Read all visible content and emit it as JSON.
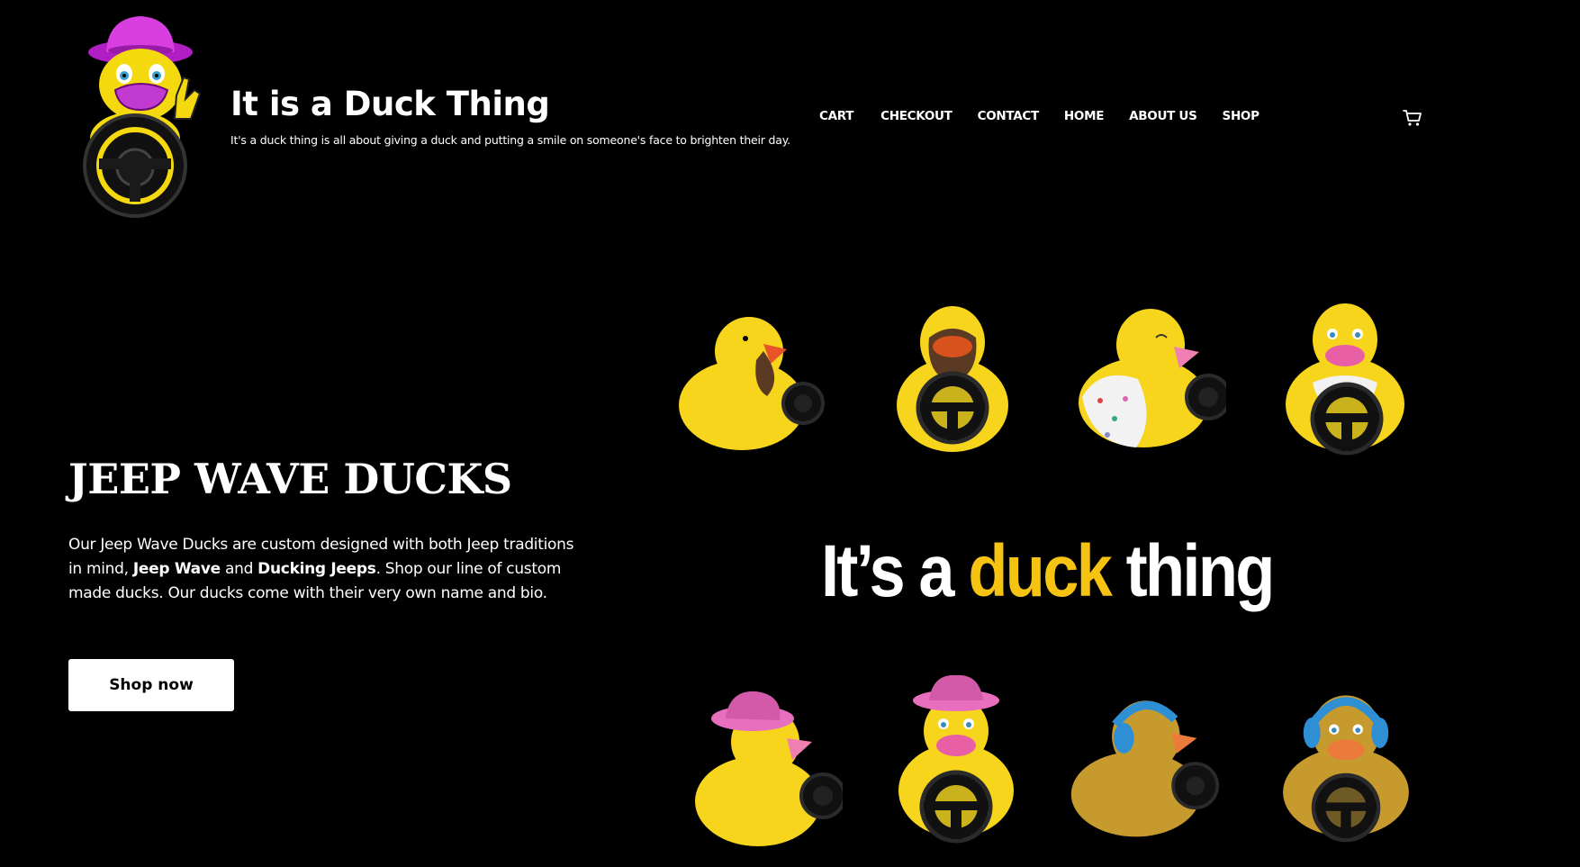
{
  "site": {
    "title": "It is a Duck Thing",
    "tagline": "It's a duck thing is all about giving a duck and putting a smile on someone's face to brighten their day."
  },
  "nav": {
    "items": [
      "CART",
      "CHECKOUT",
      "CONTACT",
      "HOME",
      "ABOUT US",
      "SHOP"
    ]
  },
  "header_icons": {
    "cart": "cart-icon"
  },
  "hero": {
    "heading": "JEEP WAVE DUCKS",
    "text_part1": "Our Jeep Wave Ducks are custom designed with both Jeep traditions in mind, ",
    "text_bold1": "Jeep Wave",
    "text_and": " and ",
    "text_bold2": "Ducking Jeeps",
    "text_part2": ". Shop our line of custom made ducks. Our ducks come with their very own name and bio.",
    "button_label": "Shop now"
  },
  "banner": {
    "slogan_part1": "It’s a ",
    "slogan_highlight": "duck",
    "slogan_part2": " thing"
  },
  "colors": {
    "background": "#000000",
    "text": "#ffffff",
    "accent_yellow": "#f6c313",
    "button_bg": "#ffffff"
  }
}
